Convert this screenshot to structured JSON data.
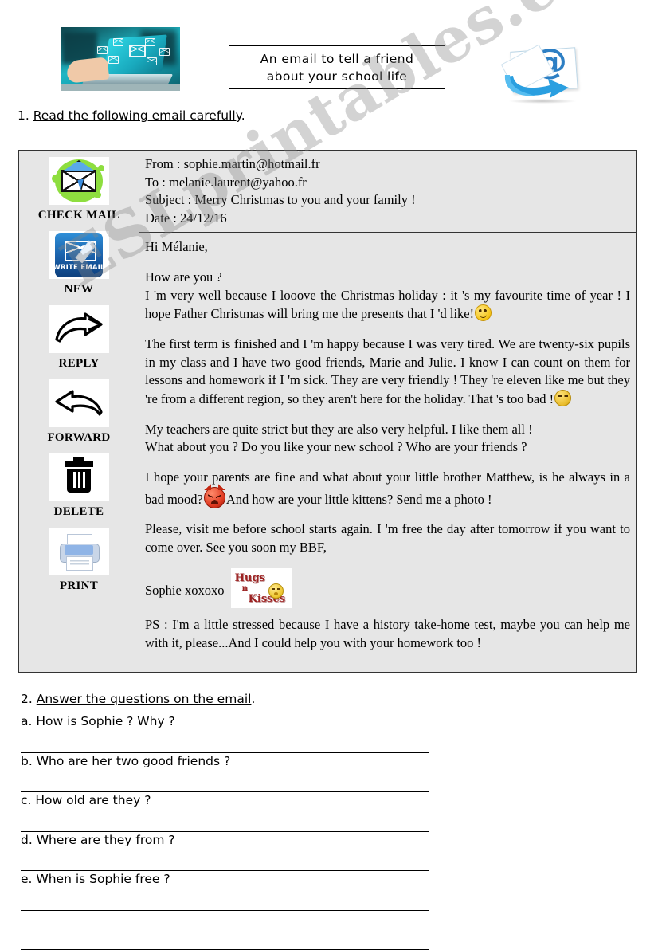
{
  "header": {
    "laptop_photo_alt": "laptop with floating email icons",
    "title_line_1": "An email  to  tell  a friend",
    "title_line_2": "about  your  school life",
    "at_icon_alt": "envelope with at symbol"
  },
  "instructions": {
    "one_number": "1.",
    "one_text": "Read the following email carefully",
    "one_period": ".",
    "two_number": "2.",
    "two_text": "Answer the questions on the email",
    "two_period": "."
  },
  "mail_sidebar": {
    "items": [
      {
        "icon": "check-mail-icon",
        "label": "CHECK MAIL"
      },
      {
        "icon": "write-email-icon",
        "label": "NEW",
        "badge": "WRITE EMAIL"
      },
      {
        "icon": "reply-arrow-icon",
        "label": "REPLY"
      },
      {
        "icon": "forward-arrow-icon",
        "label": "FORWARD"
      },
      {
        "icon": "trash-icon",
        "label": "DELETE"
      },
      {
        "icon": "printer-icon",
        "label": "PRINT"
      }
    ]
  },
  "email": {
    "from_label": "From : ",
    "from_value": "sophie.martin@hotmail.fr",
    "to_label": "To : ",
    "to_value": "melanie.laurent@yahoo.fr",
    "subject_label": "Subject : ",
    "subject_value": "Merry Christmas to you and your family !",
    "date_label": "Date : ",
    "date_value": "24/12/16",
    "greeting": "Hi Mélanie,",
    "p1_line1": "How are you ?",
    "p1_line2": "I 'm very well because I looove the Christmas holiday : it 's my favourite time of year ! I hope Father Christmas will bring me the presents that I 'd like!",
    "p2": "The first term is finished and I 'm happy because I was very tired. We are twenty-six pupils in my class and I have two good friends, Marie and Julie. I know I can count on them for lessons and homework if I 'm sick. They are very friendly ! They 're eleven like me but they 're from a different region, so they aren't here for the holiday. That 's too bad !",
    "p3_line1": "My teachers are quite strict but they are also very helpful. I like them all !",
    "p3_line2": "What about you ? Do you like your new school ? Who are your friends ?",
    "p4_a": "I hope your parents are fine and what about your little brother Matthew, is he always in a bad mood?",
    "p4_b": "And how are your little kittens? Send me a photo !",
    "p5": "Please, visit me before school starts again. I 'm free the day after tomorrow if you want to come over. See you soon my BBF,",
    "signature": "Sophie xoxoxo",
    "hugs_word_1": "Hugs",
    "hugs_word_2": "n",
    "hugs_word_3": "Kisses",
    "ps": "PS : I'm a little stressed because I have a history take-home test, maybe you can help me with it, please...And I could help you with your homework too !"
  },
  "questions": [
    "a. How is Sophie ? Why ?",
    "b. Who are her two good friends ?",
    "c. How old are they ?",
    "d. Where are they from ?",
    "e. When is Sophie free ?"
  ],
  "watermark": {
    "text": "ESLprintables.com"
  },
  "colors": {
    "table_bg": "#e6e6e6",
    "border": "#333333",
    "accent_green": "#8ede3f",
    "accent_blue": "#2d7fc4"
  }
}
